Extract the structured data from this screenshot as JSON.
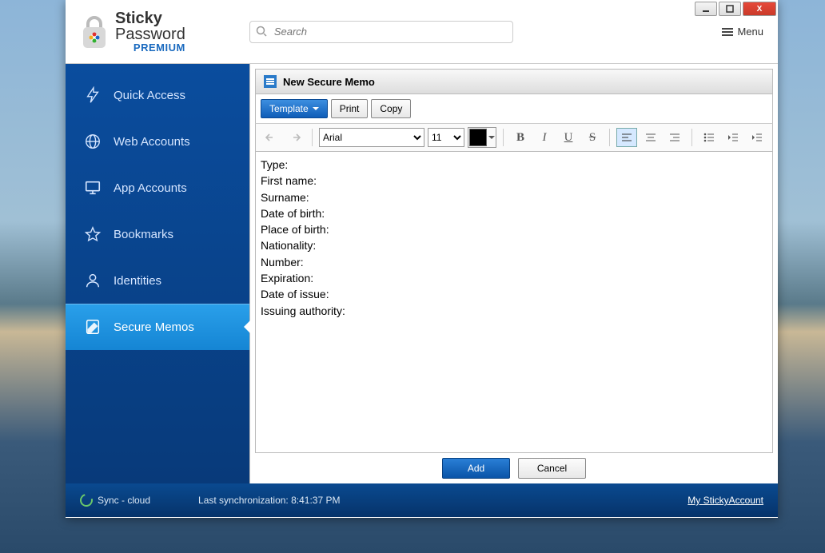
{
  "logo": {
    "l1": "Sticky",
    "l2": "Password",
    "l3": "PREMIUM"
  },
  "search": {
    "placeholder": "Search"
  },
  "menu_label": "Menu",
  "sidebar": {
    "items": [
      {
        "label": "Quick Access"
      },
      {
        "label": "Web Accounts"
      },
      {
        "label": "App Accounts"
      },
      {
        "label": "Bookmarks"
      },
      {
        "label": "Identities"
      },
      {
        "label": "Secure Memos"
      }
    ]
  },
  "panel": {
    "title": "New Secure Memo"
  },
  "toolbar": {
    "template_label": "Template",
    "print_label": "Print",
    "copy_label": "Copy"
  },
  "format": {
    "font": "Arial",
    "size": "11"
  },
  "memo": {
    "lines": [
      "Type:",
      "First name:",
      "Surname:",
      "Date of birth:",
      "Place of birth:",
      "Nationality:",
      "Number:",
      "Expiration:",
      "Date of issue:",
      "Issuing authority:"
    ]
  },
  "actions": {
    "add": "Add",
    "cancel": "Cancel"
  },
  "status": {
    "sync_label": "Sync - cloud",
    "last_sync": "Last synchronization: 8:41:37 PM",
    "account_link": "My StickyAccount"
  }
}
